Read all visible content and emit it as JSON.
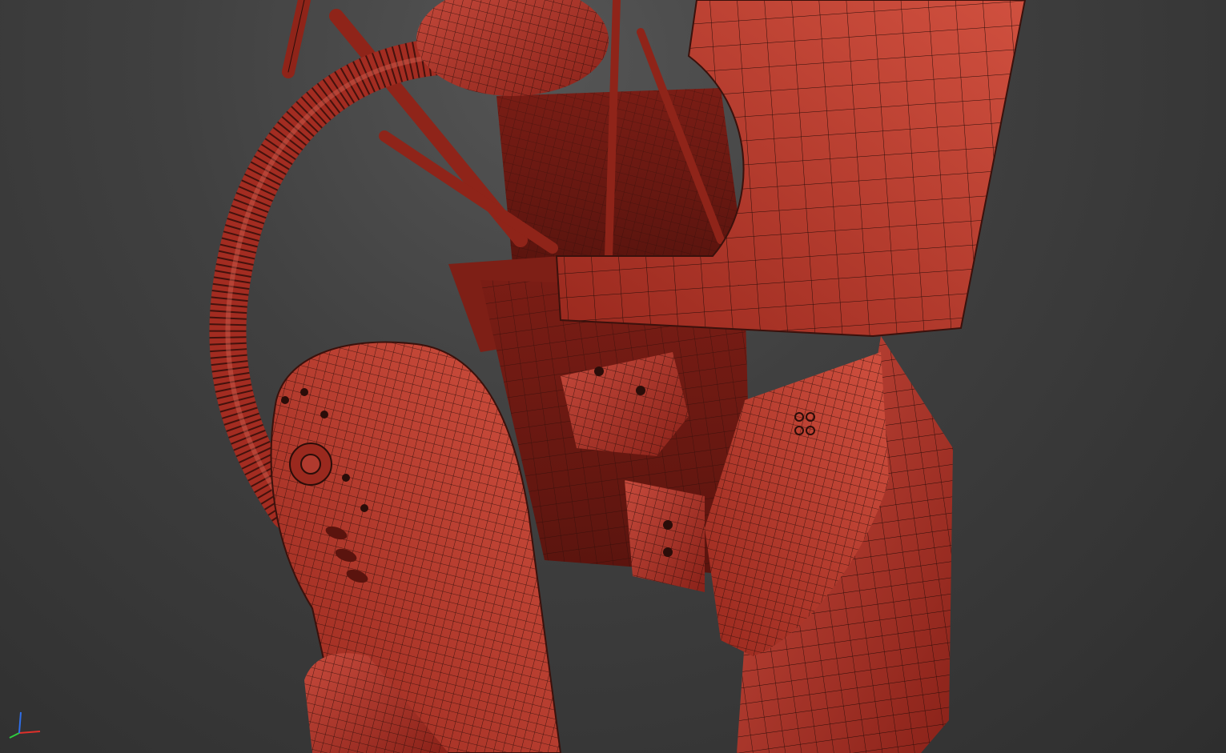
{
  "viewport": {
    "render_mode": "shaded-wireframe",
    "background_color": "#3a3a3a",
    "mesh_color": "#b8362c",
    "wire_color": "#2a0d09"
  },
  "axis_gizmo": {
    "x_color": "#e0302a",
    "y_color": "#2ecc40",
    "z_color": "#2f6ee8"
  }
}
